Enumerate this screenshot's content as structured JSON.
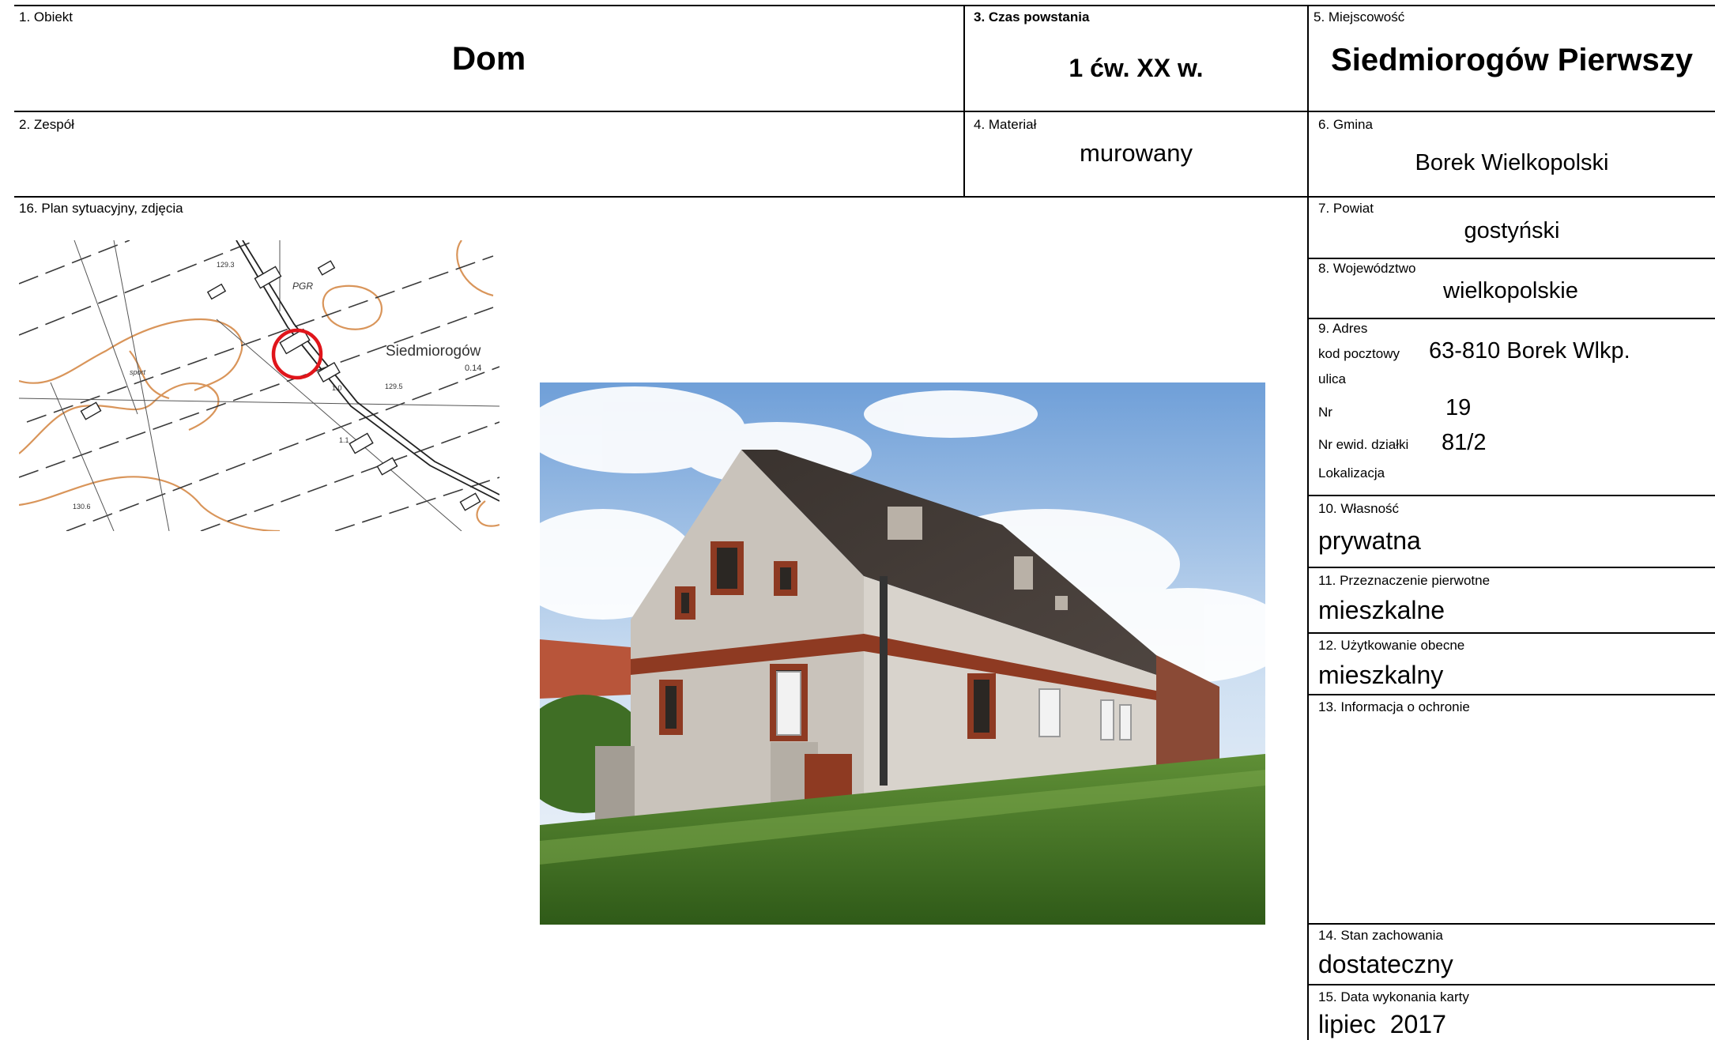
{
  "obiekt": {
    "label": "1. Obiekt",
    "value": "Dom"
  },
  "zespol": {
    "label": "2. Zespół",
    "value": ""
  },
  "czas": {
    "label": "3. Czas powstania",
    "value": "1 ćw. XX w."
  },
  "material": {
    "label": "4. Materiał",
    "value": "murowany"
  },
  "miejscowosc": {
    "label": "5. Miejscowość",
    "value": "Siedmiorogów Pierwszy"
  },
  "gmina": {
    "label": "6. Gmina",
    "value": "Borek Wielkopolski"
  },
  "powiat": {
    "label": "7. Powiat",
    "value": "gostyński"
  },
  "wojewodztwo": {
    "label": "8. Województwo",
    "value": "wielkopolskie"
  },
  "adres": {
    "label": "9. Adres",
    "kod_label": "kod pocztowy",
    "kod_value": "63-810 Borek Wlkp.",
    "ulica_label": "ulica",
    "ulica_value": "",
    "nr_label": "Nr",
    "nr_value": "19",
    "dzialka_label": "Nr ewid. działki",
    "dzialka_value": "81/2",
    "lokalizacja_label": "Lokalizacja",
    "lokalizacja_value": ""
  },
  "wlasnosc": {
    "label": "10. Własność",
    "value": "prywatna"
  },
  "przeznaczenie": {
    "label": "11. Przeznaczenie pierwotne",
    "value": "mieszkalne"
  },
  "uzytkowanie": {
    "label": "12. Użytkowanie obecne",
    "value": "mieszkalny"
  },
  "ochrona": {
    "label": "13. Informacja o ochronie",
    "value": ""
  },
  "stan": {
    "label": "14. Stan zachowania",
    "value": "dostateczny"
  },
  "data_karty": {
    "label": "15. Data wykonania karty",
    "value": "lipiec  2017"
  },
  "plan": {
    "label": "16. Plan sytuacyjny, zdjęcia"
  },
  "map": {
    "place_label": "Siedmiorogów",
    "elev_label": "0.14",
    "pgr_label": "PGR",
    "sport_label": "sport",
    "h1": "129.3",
    "h2": "129.5",
    "h3": "130.6",
    "h4": "1.0",
    "h5": "1.1",
    "contour_color": "#d9955a",
    "marker_color": "#e0151b"
  }
}
